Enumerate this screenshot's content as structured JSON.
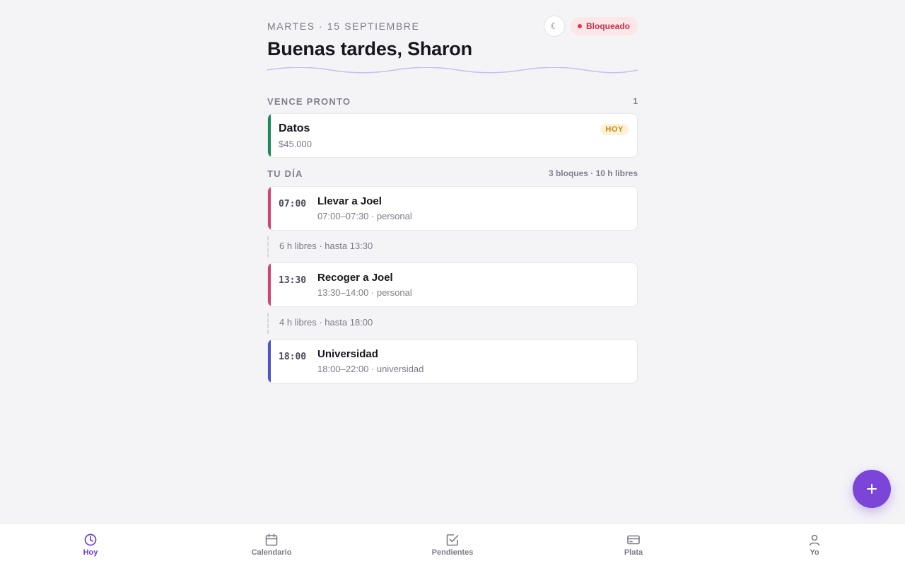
{
  "header": {
    "date": "MARTES · 15 SEPTIEMBRE",
    "greeting": "Buenas tardes, Sharon",
    "theme_toggle_icon": "moon-icon",
    "status": {
      "label": "Bloqueado",
      "color": "#e0354e"
    }
  },
  "due_soon": {
    "title": "VENCE PRONTO",
    "count": "1",
    "items": [
      {
        "title": "Datos",
        "amount": "$45.000",
        "badge": "HOY",
        "accent": "#1a8a5b"
      }
    ]
  },
  "day": {
    "title": "TU DÍA",
    "summary": "3 bloques · 10 h libres",
    "events": [
      {
        "time": "07:00",
        "title": "Llevar a Joel",
        "meta": "07:00–07:30 · personal",
        "accent": "#d2446f"
      },
      {
        "time": "13:30",
        "title": "Recoger a Joel",
        "meta": "13:30–14:00 · personal",
        "accent": "#d2446f"
      },
      {
        "time": "18:00",
        "title": "Universidad",
        "meta": "18:00–22:00 · universidad",
        "accent": "#4a55c9"
      }
    ],
    "gaps": [
      {
        "text": "6 h libres · hasta 13:30"
      },
      {
        "text": "4 h libres · hasta 18:00"
      }
    ]
  },
  "fab": {
    "icon": "plus-icon",
    "color": "#7b45d9"
  },
  "nav": {
    "items": [
      {
        "label": "Hoy",
        "icon": "clock-icon",
        "active": true
      },
      {
        "label": "Calendario",
        "icon": "calendar-icon",
        "active": false
      },
      {
        "label": "Pendientes",
        "icon": "checkbox-icon",
        "active": false
      },
      {
        "label": "Plata",
        "icon": "credit-card-icon",
        "active": false
      },
      {
        "label": "Yo",
        "icon": "user-icon",
        "active": false
      }
    ]
  }
}
